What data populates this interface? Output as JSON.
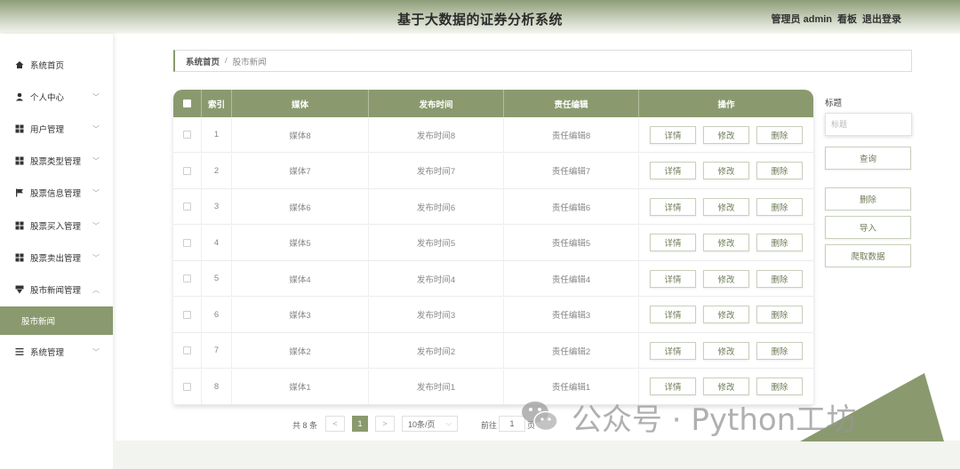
{
  "header": {
    "title": "基于大数据的证券分析系统",
    "user_role": "管理员 admin",
    "dashboard": "看板",
    "logout": "退出登录"
  },
  "sidebar": {
    "items": [
      {
        "label": "系统首页",
        "icon": "home-icon",
        "arrow": ""
      },
      {
        "label": "个人中心",
        "icon": "user-icon",
        "arrow": "﹀"
      },
      {
        "label": "用户管理",
        "icon": "grid-icon",
        "arrow": "﹀"
      },
      {
        "label": "股票类型管理",
        "icon": "grid-icon",
        "arrow": "﹀"
      },
      {
        "label": "股票信息管理",
        "icon": "flag-icon",
        "arrow": "﹀"
      },
      {
        "label": "股票买入管理",
        "icon": "grid-icon",
        "arrow": "﹀"
      },
      {
        "label": "股票卖出管理",
        "icon": "grid-icon",
        "arrow": "﹀"
      },
      {
        "label": "股市新闻管理",
        "icon": "funnel-icon",
        "arrow": "︿"
      },
      {
        "label": "股市新闻",
        "icon": "",
        "arrow": ""
      },
      {
        "label": "系统管理",
        "icon": "list-icon",
        "arrow": "﹀"
      }
    ]
  },
  "breadcrumb": {
    "home": "系统首页",
    "separator": "/",
    "current": "股市新闻"
  },
  "table": {
    "headers": {
      "index": "索引",
      "media": "媒体",
      "publish_time": "发布时间",
      "editor": "责任编辑",
      "actions": "操作"
    },
    "action_labels": {
      "detail": "详情",
      "edit": "修改",
      "delete": "删除"
    },
    "rows": [
      {
        "index": "1",
        "media": "媒体8",
        "publish_time": "发布时间8",
        "editor": "责任编辑8"
      },
      {
        "index": "2",
        "media": "媒体7",
        "publish_time": "发布时间7",
        "editor": "责任编辑7"
      },
      {
        "index": "3",
        "media": "媒体6",
        "publish_time": "发布时间6",
        "editor": "责任编辑6"
      },
      {
        "index": "4",
        "media": "媒体5",
        "publish_time": "发布时间5",
        "editor": "责任编辑5"
      },
      {
        "index": "5",
        "media": "媒体4",
        "publish_time": "发布时间4",
        "editor": "责任编辑4"
      },
      {
        "index": "6",
        "media": "媒体3",
        "publish_time": "发布时间3",
        "editor": "责任编辑3"
      },
      {
        "index": "7",
        "media": "媒体2",
        "publish_time": "发布时间2",
        "editor": "责任编辑2"
      },
      {
        "index": "8",
        "media": "媒体1",
        "publish_time": "发布时间1",
        "editor": "责任编辑1"
      }
    ]
  },
  "search_panel": {
    "label": "标题",
    "placeholder": "标题",
    "query": "查询",
    "delete": "删除",
    "import": "导入",
    "crawl": "爬取数据"
  },
  "pagination": {
    "total": "共 8 条",
    "prev": "<",
    "current_page": "1",
    "next": ">",
    "page_size": "10条/页",
    "goto_label": "前往",
    "goto_value": "1",
    "goto_suffix": "页"
  },
  "watermark": {
    "text": "公众号 · Python工坊"
  },
  "colors": {
    "accent": "#8a9a6e",
    "button_text": "#6d7b56"
  }
}
